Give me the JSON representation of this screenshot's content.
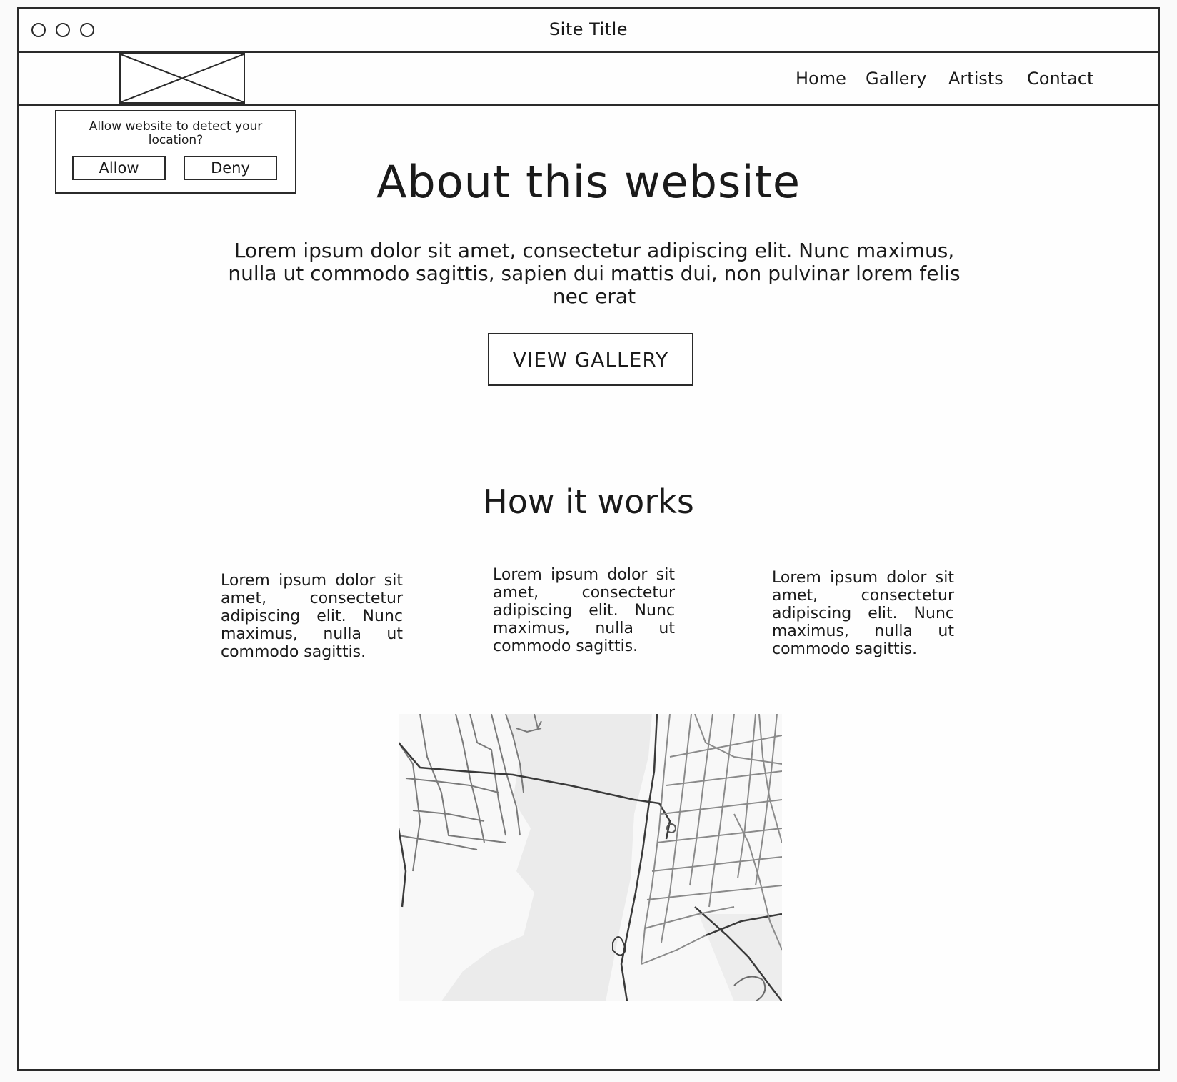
{
  "window": {
    "title": "Site Title"
  },
  "header": {
    "logo": "logo-placeholder",
    "nav": [
      "Home",
      "Gallery",
      "Artists",
      "Contact"
    ]
  },
  "location_prompt": {
    "message": "Allow website to detect your location?",
    "allow_label": "Allow",
    "deny_label": "Deny"
  },
  "about": {
    "heading": "About this website",
    "body": "Lorem ipsum dolor sit amet, consectetur adipiscing elit. Nunc maximus, nulla ut commodo sagittis, sapien dui mattis dui, non pulvinar lorem felis nec erat",
    "cta_label": "VIEW GALLERY"
  },
  "how_it_works": {
    "heading": "How it works",
    "columns": [
      "Lorem ipsum dolor sit amet, consectetur adipiscing elit. Nunc maximus, nulla ut commodo sagittis.",
      "Lorem ipsum dolor sit amet, consectetur adipiscing elit. Nunc maximus, nulla ut commodo sagittis.",
      "Lorem ipsum dolor sit amet, consectetur adipiscing elit. Nunc maximus, nulla ut commodo sagittis."
    ]
  },
  "map": {
    "kind": "street-map"
  }
}
